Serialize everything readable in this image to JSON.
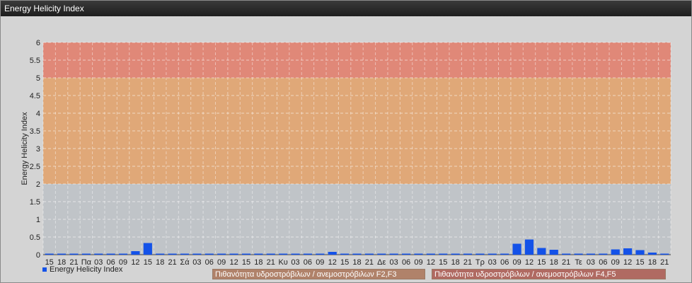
{
  "window": {
    "title": "Energy Helicity Index"
  },
  "chart_data": {
    "type": "bar",
    "ylabel": "Energy Helicity Index",
    "ylim": [
      0,
      6
    ],
    "yticks": [
      "0",
      "0.5",
      "1",
      "1.5",
      "2",
      "2.5",
      "3",
      "3.5",
      "4",
      "4.5",
      "5",
      "5.5",
      "6"
    ],
    "categories": [
      "15",
      "18",
      "21",
      "Πα",
      "03",
      "06",
      "09",
      "12",
      "15",
      "18",
      "21",
      "Σά",
      "03",
      "06",
      "09",
      "12",
      "15",
      "18",
      "21",
      "Κυ",
      "03",
      "06",
      "09",
      "12",
      "15",
      "18",
      "21",
      "Δε",
      "03",
      "06",
      "09",
      "12",
      "15",
      "18",
      "21",
      "Τρ",
      "03",
      "06",
      "09",
      "12",
      "15",
      "18",
      "21",
      "Τε",
      "03",
      "06",
      "09",
      "12",
      "15",
      "18",
      "21"
    ],
    "series": [
      {
        "name": "Energy Helicity Index",
        "color": "#1452e8",
        "values": [
          0.02,
          0.01,
          0.01,
          0.01,
          0.01,
          0.01,
          0.01,
          0.1,
          0.33,
          0.02,
          0.01,
          0.01,
          0.01,
          0.01,
          0.01,
          0.01,
          0.01,
          0.01,
          0.01,
          0.01,
          0.01,
          0.01,
          0.01,
          0.08,
          0.01,
          0.01,
          0.01,
          0.01,
          0.01,
          0.01,
          0.01,
          0.01,
          0.01,
          0.01,
          0.01,
          0.01,
          0.01,
          0.01,
          0.31,
          0.43,
          0.19,
          0.14,
          0.02,
          0.01,
          0.01,
          0.01,
          0.15,
          0.18,
          0.13,
          0.06,
          0.02
        ]
      }
    ],
    "bands": [
      {
        "from": 2,
        "to": 5,
        "color": "#e0a878",
        "label": "Πιθανότητα υδροστρόβιλων / ανεμοστρόβιλων F2,F3"
      },
      {
        "from": 5,
        "to": 6,
        "color": "#e08878",
        "label": "Πιθανότητα υδροστρόβιλων / ανεμοστρόβιλων F4,F5"
      }
    ],
    "grid": true,
    "legend_placement": "bottom"
  }
}
